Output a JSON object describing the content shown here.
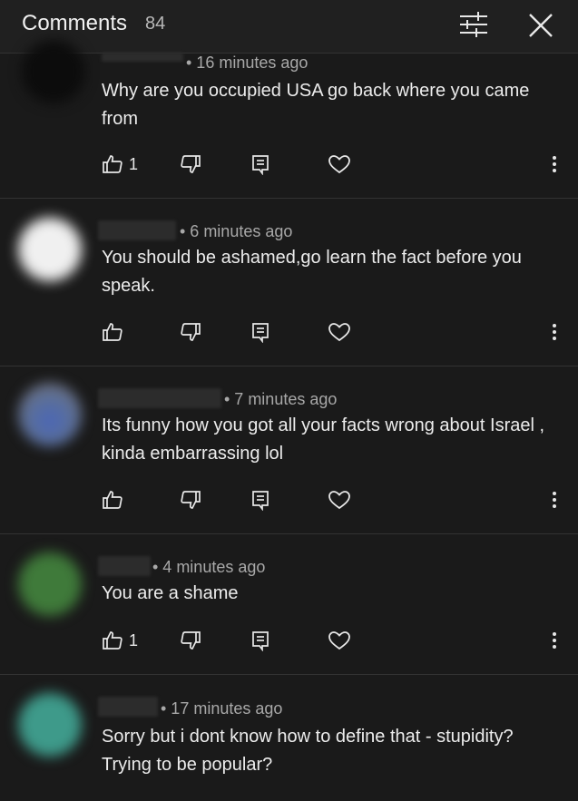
{
  "header": {
    "title": "Comments",
    "count": "84"
  },
  "comments": [
    {
      "time": "• 16 minutes ago",
      "text": "Why are you occupied USA go back where you came from",
      "likes": "1"
    },
    {
      "time": "• 6 minutes ago",
      "text": "You should be ashamed,go learn the fact before you speak.",
      "likes": ""
    },
    {
      "time": "• 7 minutes ago",
      "text": "Its funny how you got all your facts wrong about Israel , kinda embarrassing lol",
      "likes": ""
    },
    {
      "time": "• 4 minutes ago",
      "text": "You are a shame",
      "likes": "1"
    },
    {
      "time": "• 17 minutes ago",
      "text": "Sorry but i dont know how to define that - stupidity? Trying to be popular?",
      "likes": ""
    }
  ],
  "icons": {
    "filter": "filter-sliders-icon",
    "close": "close-icon",
    "like": "thumbs-up-icon",
    "dislike": "thumbs-down-icon",
    "reply": "reply-icon",
    "heart": "heart-icon",
    "more": "more-vertical-icon"
  },
  "colors": {
    "background": "#1a1a1a",
    "header": "#202020",
    "text": "#ececec",
    "meta": "#a8a8a8"
  }
}
